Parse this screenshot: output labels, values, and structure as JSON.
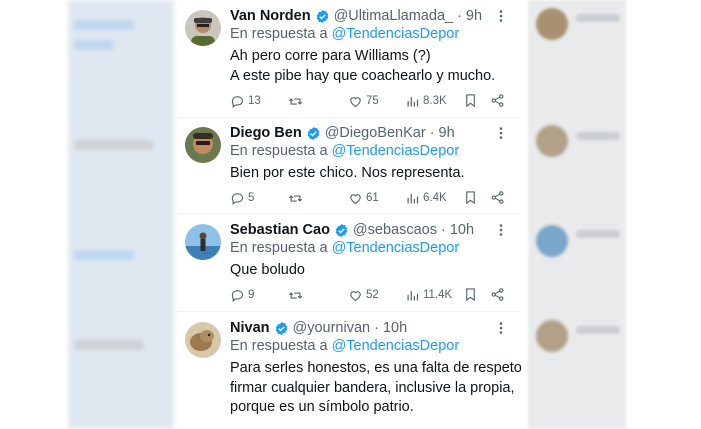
{
  "reply_prefix": "En respuesta a",
  "tweets": [
    {
      "name": "Van Norden",
      "handle": "@UltimaLlamada_",
      "dot": "·",
      "time": "9h",
      "mention": "@TendenciasDepor",
      "text_lines": [
        "Ah pero corre para Williams (?)",
        "A este pibe hay que coachearlo y mucho."
      ],
      "replies": "13",
      "retweets": "",
      "likes": "75",
      "views": "8.3K"
    },
    {
      "name": "Diego Ben",
      "handle": "@DiegoBenKar",
      "dot": "·",
      "time": "9h",
      "mention": "@TendenciasDepor",
      "text_lines": [
        "Bien por este chico. Nos representa."
      ],
      "replies": "5",
      "retweets": "",
      "likes": "61",
      "views": "6.4K"
    },
    {
      "name": "Sebastian Cao",
      "handle": "@sebascaos",
      "dot": "·",
      "time": "10h",
      "mention": "@TendenciasDepor",
      "text_lines": [
        "Que boludo"
      ],
      "replies": "9",
      "retweets": "",
      "likes": "52",
      "views": "11.4K"
    },
    {
      "name": "Nivan",
      "handle": "@yournivan",
      "dot": "·",
      "time": "10h",
      "mention": "@TendenciasDepor",
      "text_lines": [
        "Para serles honestos, es una falta de respeto",
        "firmar cualquier bandera, inclusive la propia,",
        "porque es un símbolo patrio."
      ]
    }
  ],
  "colors": {
    "accent": "#1d9bf0",
    "text": "#0f1419",
    "muted": "#536471",
    "border": "#eff3f4"
  },
  "icons": [
    "verified-badge-icon",
    "more-icon",
    "reply-icon",
    "retweet-icon",
    "like-icon",
    "views-icon",
    "bookmark-icon",
    "share-icon"
  ]
}
